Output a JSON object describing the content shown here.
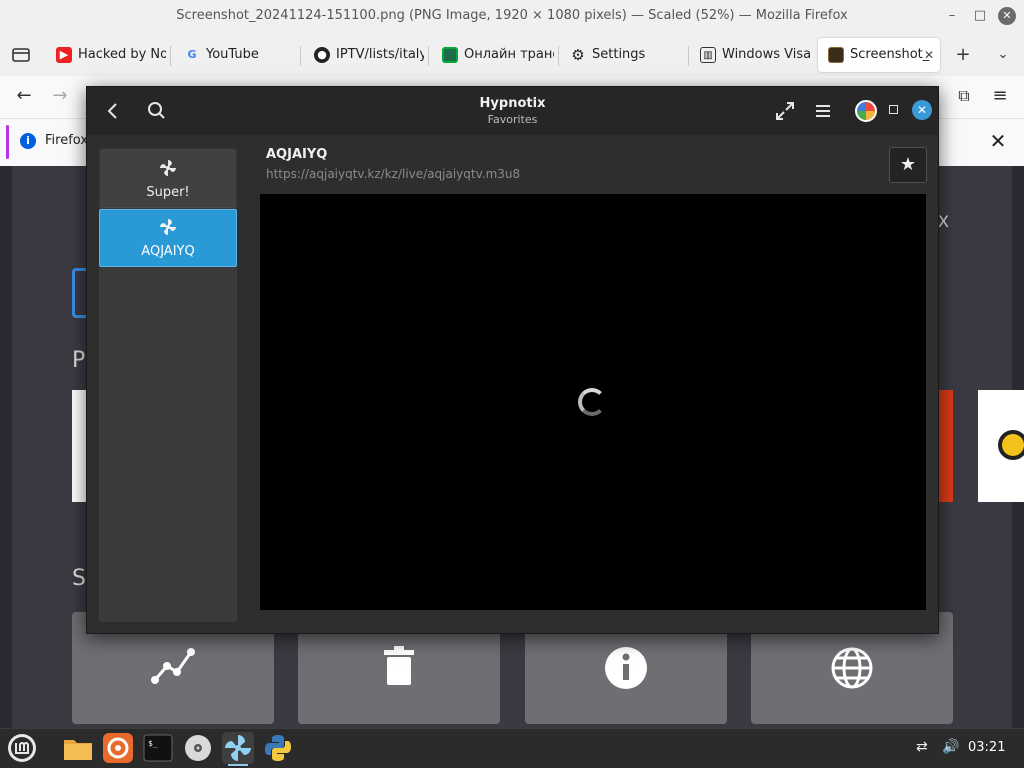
{
  "firefox": {
    "window_title": "Screenshot_20241124-151100.png (PNG Image, 1920 × 1080 pixels) — Scaled (52%) — Mozilla Firefox",
    "tabs": [
      {
        "label": "Hacked by No",
        "icon": "youtube-icon"
      },
      {
        "label": "YouTube",
        "icon": "google-icon"
      },
      {
        "label": "IPTV/lists/italy",
        "icon": "github-icon"
      },
      {
        "label": "Онлайн транс",
        "icon": "site-icon"
      },
      {
        "label": "Settings",
        "icon": "gear-icon"
      },
      {
        "label": "Windows Visa",
        "icon": "building-icon"
      },
      {
        "label": "Screenshot_",
        "icon": "image-icon",
        "active": true
      }
    ],
    "notification": {
      "text": "Firefox"
    },
    "background_fragments": {
      "x_fragment": "X",
      "p_fragment": "P",
      "s_fragment": "S"
    }
  },
  "hypnotix": {
    "title": "Hypnotix",
    "subtitle": "Favorites",
    "sidebar": [
      {
        "label": "Super!",
        "selected": false
      },
      {
        "label": "AQJAIYQ",
        "selected": true
      }
    ],
    "channel": {
      "name": "AQJAIYQ",
      "url": "https://aqjaiyqtv.kz/kz/live/aqjaiyqtv.m3u8"
    },
    "player_state": "loading"
  },
  "taskbar": {
    "apps": [
      "mint-menu-icon",
      "files-icon",
      "firefox-icon",
      "terminal-icon",
      "disc-icon",
      "hypnotix-icon",
      "python-icon"
    ],
    "clock": "03:21"
  },
  "colors": {
    "accent_blue": "#2a9ad6",
    "hypnotix_bg": "#2e2e2e",
    "video_bg": "#000000"
  }
}
